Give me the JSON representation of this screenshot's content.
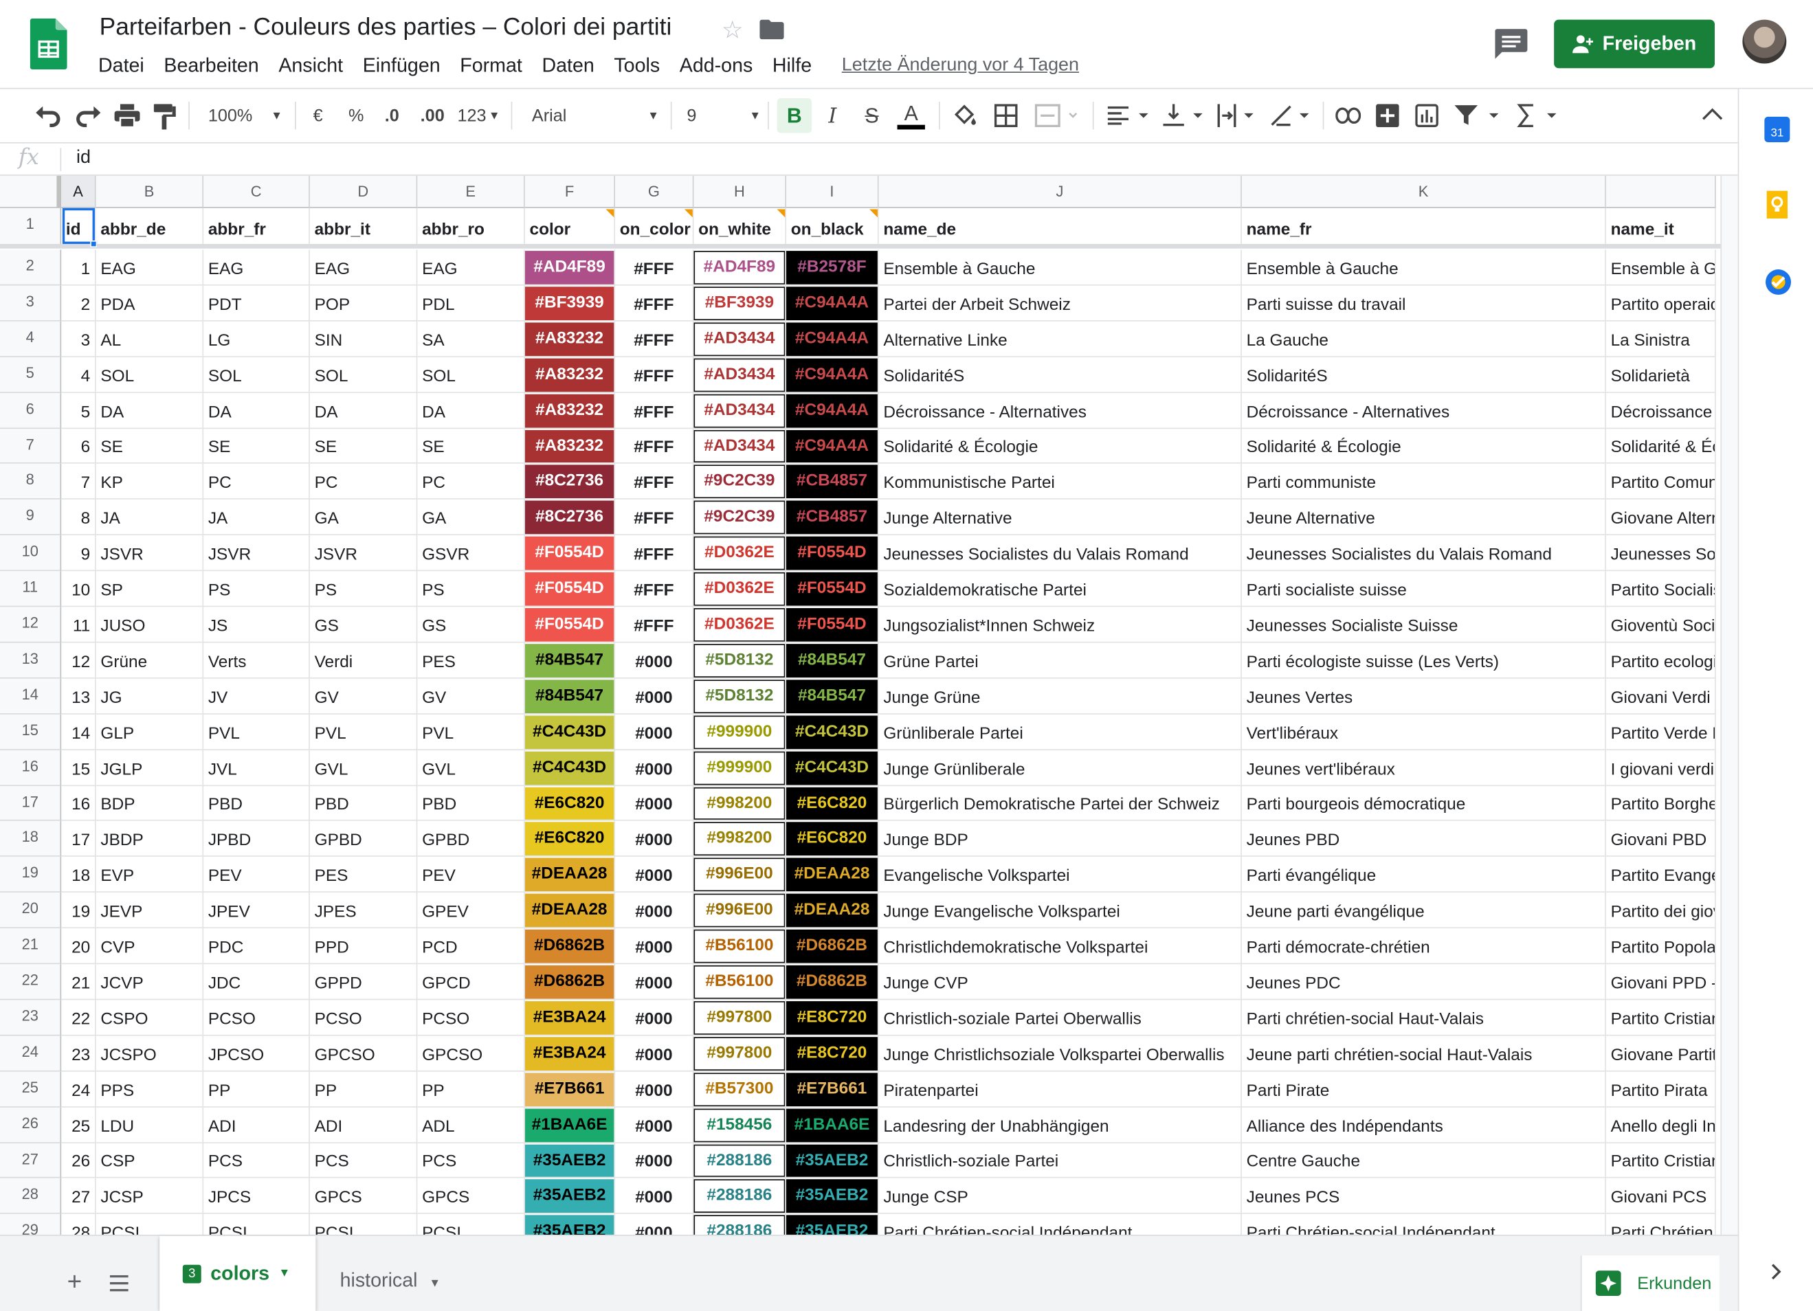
{
  "document": {
    "title": "Parteifarben - Couleurs des parties – Colori dei partiti",
    "last_edit": "Letzte Änderung vor 4 Tagen",
    "share_label": "Freigeben"
  },
  "menu": [
    "Datei",
    "Bearbeiten",
    "Ansicht",
    "Einfügen",
    "Format",
    "Daten",
    "Tools",
    "Add-ons",
    "Hilfe"
  ],
  "toolbar": {
    "zoom": "100%",
    "currency": "€",
    "percent": "%",
    "dec_less": ".0",
    "dec_more": ".00",
    "number_format": "123",
    "font": "Arial",
    "font_size": "9"
  },
  "formula_bar": {
    "fx": "fx",
    "value": "id"
  },
  "columns": [
    "A",
    "B",
    "C",
    "D",
    "E",
    "F",
    "G",
    "H",
    "I",
    "J",
    "K",
    ""
  ],
  "header_row": [
    "id",
    "abbr_de",
    "abbr_fr",
    "abbr_it",
    "abbr_ro",
    "color",
    "on_color",
    "on_white",
    "on_black",
    "name_de",
    "name_fr",
    "name_it"
  ],
  "rows": [
    {
      "n": "2",
      "id": "1",
      "de": "EAG",
      "fr": "EAG",
      "it": "EAG",
      "ro": "EAG",
      "color": "#AD4F89",
      "on": "#FFF",
      "white": "#AD4F89",
      "black": "#B2578F",
      "name_de": "Ensemble à Gauche",
      "name_fr": "Ensemble à Gauche",
      "name_it": "Ensemble à Ga"
    },
    {
      "n": "3",
      "id": "2",
      "de": "PDA",
      "fr": "PDT",
      "it": "POP",
      "ro": "PDL",
      "color": "#BF3939",
      "on": "#FFF",
      "white": "#BF3939",
      "black": "#C94A4A",
      "name_de": "Partei der Arbeit Schweiz",
      "name_fr": "Parti suisse du travail",
      "name_it": "Partito operaio"
    },
    {
      "n": "4",
      "id": "3",
      "de": "AL",
      "fr": "LG",
      "it": "SIN",
      "ro": "SA",
      "color": "#A83232",
      "on": "#FFF",
      "white": "#AD3434",
      "black": "#C94A4A",
      "name_de": "Alternative Linke",
      "name_fr": "La Gauche",
      "name_it": "La Sinistra"
    },
    {
      "n": "5",
      "id": "4",
      "de": "SOL",
      "fr": "SOL",
      "it": "SOL",
      "ro": "SOL",
      "color": "#A83232",
      "on": "#FFF",
      "white": "#AD3434",
      "black": "#C94A4A",
      "name_de": "SolidaritéS",
      "name_fr": "SolidaritéS",
      "name_it": "Solidarietà"
    },
    {
      "n": "6",
      "id": "5",
      "de": "DA",
      "fr": "DA",
      "it": "DA",
      "ro": "DA",
      "color": "#A83232",
      "on": "#FFF",
      "white": "#AD3434",
      "black": "#C94A4A",
      "name_de": "Décroissance - Alternatives",
      "name_fr": "Décroissance - Alternatives",
      "name_it": "Décroissance -"
    },
    {
      "n": "7",
      "id": "6",
      "de": "SE",
      "fr": "SE",
      "it": "SE",
      "ro": "SE",
      "color": "#A83232",
      "on": "#FFF",
      "white": "#AD3434",
      "black": "#C94A4A",
      "name_de": "Solidarité & Écologie",
      "name_fr": "Solidarité & Écologie",
      "name_it": "Solidarité & Éc"
    },
    {
      "n": "8",
      "id": "7",
      "de": "KP",
      "fr": "PC",
      "it": "PC",
      "ro": "PC",
      "color": "#8C2736",
      "on": "#FFF",
      "white": "#9C2C39",
      "black": "#CB4857",
      "name_de": "Kommunistische Partei",
      "name_fr": "Parti communiste",
      "name_it": "Partito Comuni"
    },
    {
      "n": "9",
      "id": "8",
      "de": "JA",
      "fr": "JA",
      "it": "GA",
      "ro": "GA",
      "color": "#8C2736",
      "on": "#FFF",
      "white": "#9C2C39",
      "black": "#CB4857",
      "name_de": "Junge Alternative",
      "name_fr": "Jeune Alternative",
      "name_it": "Giovane Altern"
    },
    {
      "n": "10",
      "id": "9",
      "de": "JSVR",
      "fr": "JSVR",
      "it": "JSVR",
      "ro": "GSVR",
      "color": "#F0554D",
      "on": "#FFF",
      "white": "#D0362E",
      "black": "#F0554D",
      "name_de": "Jeunesses Socialistes du Valais Romand",
      "name_fr": "Jeunesses Socialistes du Valais Romand",
      "name_it": "Jeunesses Soc"
    },
    {
      "n": "11",
      "id": "10",
      "de": "SP",
      "fr": "PS",
      "it": "PS",
      "ro": "PS",
      "color": "#F0554D",
      "on": "#FFF",
      "white": "#D0362E",
      "black": "#F0554D",
      "name_de": "Sozialdemokratische Partei",
      "name_fr": "Parti socialiste suisse",
      "name_it": "Partito Socialis"
    },
    {
      "n": "12",
      "id": "11",
      "de": "JUSO",
      "fr": "JS",
      "it": "GS",
      "ro": "GS",
      "color": "#F0554D",
      "on": "#FFF",
      "white": "#D0362E",
      "black": "#F0554D",
      "name_de": "Jungsozialist*Innen Schweiz",
      "name_fr": "Jeunesses Socialiste Suisse",
      "name_it": "Gioventù Socia"
    },
    {
      "n": "13",
      "id": "12",
      "de": "Grüne",
      "fr": "Verts",
      "it": "Verdi",
      "ro": "PES",
      "color": "#84B547",
      "on": "#000",
      "white": "#5D8132",
      "black": "#84B547",
      "name_de": "Grüne Partei",
      "name_fr": "Parti écologiste suisse (Les Verts)",
      "name_it": "Partito ecologis"
    },
    {
      "n": "14",
      "id": "13",
      "de": "JG",
      "fr": "JV",
      "it": "GV",
      "ro": "GV",
      "color": "#84B547",
      "on": "#000",
      "white": "#5D8132",
      "black": "#84B547",
      "name_de": "Junge Grüne",
      "name_fr": "Jeunes Vertes",
      "name_it": "Giovani Verdi"
    },
    {
      "n": "15",
      "id": "14",
      "de": "GLP",
      "fr": "PVL",
      "it": "PVL",
      "ro": "PVL",
      "color": "#C4C43D",
      "on": "#000",
      "white": "#999900",
      "black": "#C4C43D",
      "name_de": "Grünliberale Partei",
      "name_fr": "Vert'libéraux",
      "name_it": "Partito Verde L"
    },
    {
      "n": "16",
      "id": "15",
      "de": "JGLP",
      "fr": "JVL",
      "it": "GVL",
      "ro": "GVL",
      "color": "#C4C43D",
      "on": "#000",
      "white": "#999900",
      "black": "#C4C43D",
      "name_de": "Junge Grünliberale",
      "name_fr": "Jeunes vert'libéraux",
      "name_it": "I giovani verdi"
    },
    {
      "n": "17",
      "id": "16",
      "de": "BDP",
      "fr": "PBD",
      "it": "PBD",
      "ro": "PBD",
      "color": "#E6C820",
      "on": "#000",
      "white": "#998200",
      "black": "#E6C820",
      "name_de": "Bürgerlich Demokratische Partei der Schweiz",
      "name_fr": "Parti bourgeois démocratique",
      "name_it": "Partito Borghes"
    },
    {
      "n": "18",
      "id": "17",
      "de": "JBDP",
      "fr": "JPBD",
      "it": "GPBD",
      "ro": "GPBD",
      "color": "#E6C820",
      "on": "#000",
      "white": "#998200",
      "black": "#E6C820",
      "name_de": "Junge BDP",
      "name_fr": "Jeunes PBD",
      "name_it": "Giovani PBD"
    },
    {
      "n": "19",
      "id": "18",
      "de": "EVP",
      "fr": "PEV",
      "it": "PES",
      "ro": "PEV",
      "color": "#DEAA28",
      "on": "#000",
      "white": "#996E00",
      "black": "#DEAA28",
      "name_de": "Evangelische Volkspartei",
      "name_fr": "Parti évangélique",
      "name_it": "Partito Evange"
    },
    {
      "n": "20",
      "id": "19",
      "de": "JEVP",
      "fr": "JPEV",
      "it": "JPES",
      "ro": "GPEV",
      "color": "#DEAA28",
      "on": "#000",
      "white": "#996E00",
      "black": "#DEAA28",
      "name_de": "Junge Evangelische Volkspartei",
      "name_fr": "Jeune parti évangélique",
      "name_it": "Partito dei giov"
    },
    {
      "n": "21",
      "id": "20",
      "de": "CVP",
      "fr": "PDC",
      "it": "PPD",
      "ro": "PCD",
      "color": "#D6862B",
      "on": "#000",
      "white": "#B56100",
      "black": "#D6862B",
      "name_de": "Christlichdemokratische Volkspartei",
      "name_fr": "Parti démocrate-chrétien",
      "name_it": "Partito Popolar"
    },
    {
      "n": "22",
      "id": "21",
      "de": "JCVP",
      "fr": "JDC",
      "it": "GPPD",
      "ro": "GPCD",
      "color": "#D6862B",
      "on": "#000",
      "white": "#B56100",
      "black": "#D6862B",
      "name_de": "Junge CVP",
      "name_fr": "Jeunes PDC",
      "name_it": "Giovani PPD -"
    },
    {
      "n": "23",
      "id": "22",
      "de": "CSPO",
      "fr": "PCSO",
      "it": "PCSO",
      "ro": "PCSO",
      "color": "#E3BA24",
      "on": "#000",
      "white": "#997800",
      "black": "#E8C720",
      "name_de": "Christlich-soziale Partei Oberwallis",
      "name_fr": "Parti chrétien-social Haut-Valais",
      "name_it": "Partito Cristian"
    },
    {
      "n": "24",
      "id": "23",
      "de": "JCSPO",
      "fr": "JPCSO",
      "it": "GPCSO",
      "ro": "GPCSO",
      "color": "#E3BA24",
      "on": "#000",
      "white": "#997800",
      "black": "#E8C720",
      "name_de": "Junge Christlichsoziale Volkspartei Oberwallis",
      "name_fr": "Jeune parti chrétien-social Haut-Valais",
      "name_it": "Giovane Partito"
    },
    {
      "n": "25",
      "id": "24",
      "de": "PPS",
      "fr": "PP",
      "it": "PP",
      "ro": "PP",
      "color": "#E7B661",
      "on": "#000",
      "white": "#B57300",
      "black": "#E7B661",
      "name_de": "Piratenpartei",
      "name_fr": "Parti Pirate",
      "name_it": "Partito Pirata"
    },
    {
      "n": "26",
      "id": "25",
      "de": "LDU",
      "fr": "ADI",
      "it": "ADI",
      "ro": "ADL",
      "color": "#1BAA6E",
      "on": "#000",
      "white": "#158456",
      "black": "#1BAA6E",
      "name_de": "Landesring der Unabhängigen",
      "name_fr": "Alliance des Indépendants",
      "name_it": "Anello degli Ind"
    },
    {
      "n": "27",
      "id": "26",
      "de": "CSP",
      "fr": "PCS",
      "it": "PCS",
      "ro": "PCS",
      "color": "#35AEB2",
      "on": "#000",
      "white": "#288186",
      "black": "#35AEB2",
      "name_de": "Christlich-soziale Partei",
      "name_fr": "Centre Gauche",
      "name_it": "Partito Cristian"
    },
    {
      "n": "28",
      "id": "27",
      "de": "JCSP",
      "fr": "JPCS",
      "it": "GPCS",
      "ro": "GPCS",
      "color": "#35AEB2",
      "on": "#000",
      "white": "#288186",
      "black": "#35AEB2",
      "name_de": "Junge CSP",
      "name_fr": "Jeunes PCS",
      "name_it": "Giovani PCS"
    },
    {
      "n": "29",
      "id": "28",
      "de": "PCSI",
      "fr": "PCSI",
      "it": "PCSI",
      "ro": "PCSI",
      "color": "#35AEB2",
      "on": "#000",
      "white": "#288186",
      "black": "#35AEB2",
      "name_de": "Parti Chrétien-social Indépendant",
      "name_fr": "Parti Chrétien-social Indépendant",
      "name_it": "Parti Chrétien"
    }
  ],
  "sheets": {
    "active_count": "3",
    "active": "colors",
    "other": "historical"
  },
  "explore_label": "Erkunden",
  "side_panel": {
    "calendar_day": "31"
  },
  "colors": {
    "accent_green": "#188038",
    "selection_blue": "#1a73e8"
  }
}
